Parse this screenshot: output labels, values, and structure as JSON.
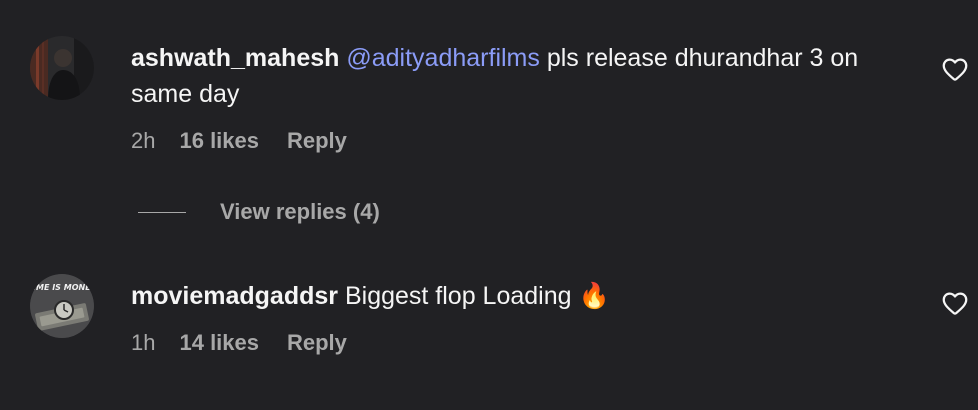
{
  "comments": [
    {
      "username": "ashwath_mahesh",
      "mention": "@adityadharfilms",
      "text": "pls release dhurandhar 3 on same day",
      "time": "2h",
      "likes": "16 likes",
      "reply_label": "Reply",
      "avatar_icon": "user-photo-avatar",
      "like_icon": "heart-outline-icon"
    },
    {
      "username": "moviemadgaddsr",
      "text": "Biggest flop Loading",
      "emoji": "🔥",
      "time": "1h",
      "likes": "14 likes",
      "reply_label": "Reply",
      "avatar_icon": "time-is-money-avatar",
      "avatar_text": "TIME IS MONEY",
      "like_icon": "heart-outline-icon"
    }
  ],
  "view_replies_label": "View replies (4)",
  "colors": {
    "background": "#212124",
    "text": "#f5f5f5",
    "muted": "#a8a8a8",
    "mention": "#8b9cf7"
  }
}
